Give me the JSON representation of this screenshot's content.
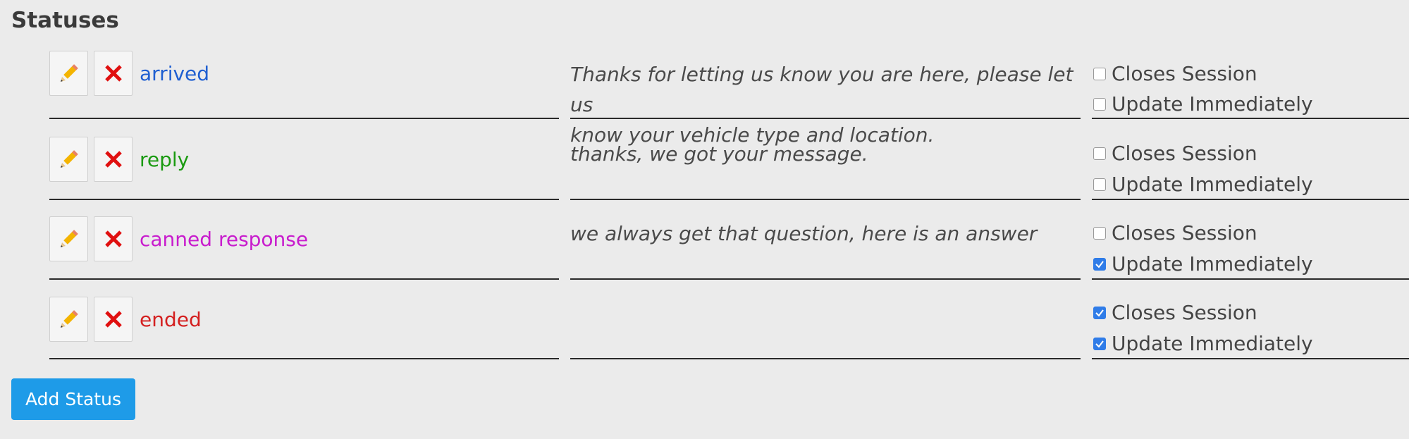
{
  "page": {
    "title": "Statuses"
  },
  "statuses": [
    {
      "name": "arrived",
      "color": "#1f5fd1",
      "message": "Thanks for letting us know you are here, please let us\nknow your vehicle type and location.",
      "closes_session": {
        "label": "Closes Session",
        "checked": false
      },
      "update_immediately": {
        "label": "Update Immediately",
        "checked": false
      }
    },
    {
      "name": "reply",
      "color": "#1a9a10",
      "message": "thanks, we got your message.",
      "closes_session": {
        "label": "Closes Session",
        "checked": false
      },
      "update_immediately": {
        "label": "Update Immediately",
        "checked": false
      }
    },
    {
      "name": "canned response",
      "color": "#c81ccd",
      "message": "we always get that question, here is an answer",
      "closes_session": {
        "label": "Closes Session",
        "checked": false
      },
      "update_immediately": {
        "label": "Update Immediately",
        "checked": true
      }
    },
    {
      "name": "ended",
      "color": "#d42020",
      "message": "",
      "closes_session": {
        "label": "Closes Session",
        "checked": true
      },
      "update_immediately": {
        "label": "Update Immediately",
        "checked": true
      }
    }
  ],
  "icons": {
    "edit": "pencil-icon",
    "delete": "close-x-icon"
  },
  "actions": {
    "add_status_label": "Add Status"
  }
}
